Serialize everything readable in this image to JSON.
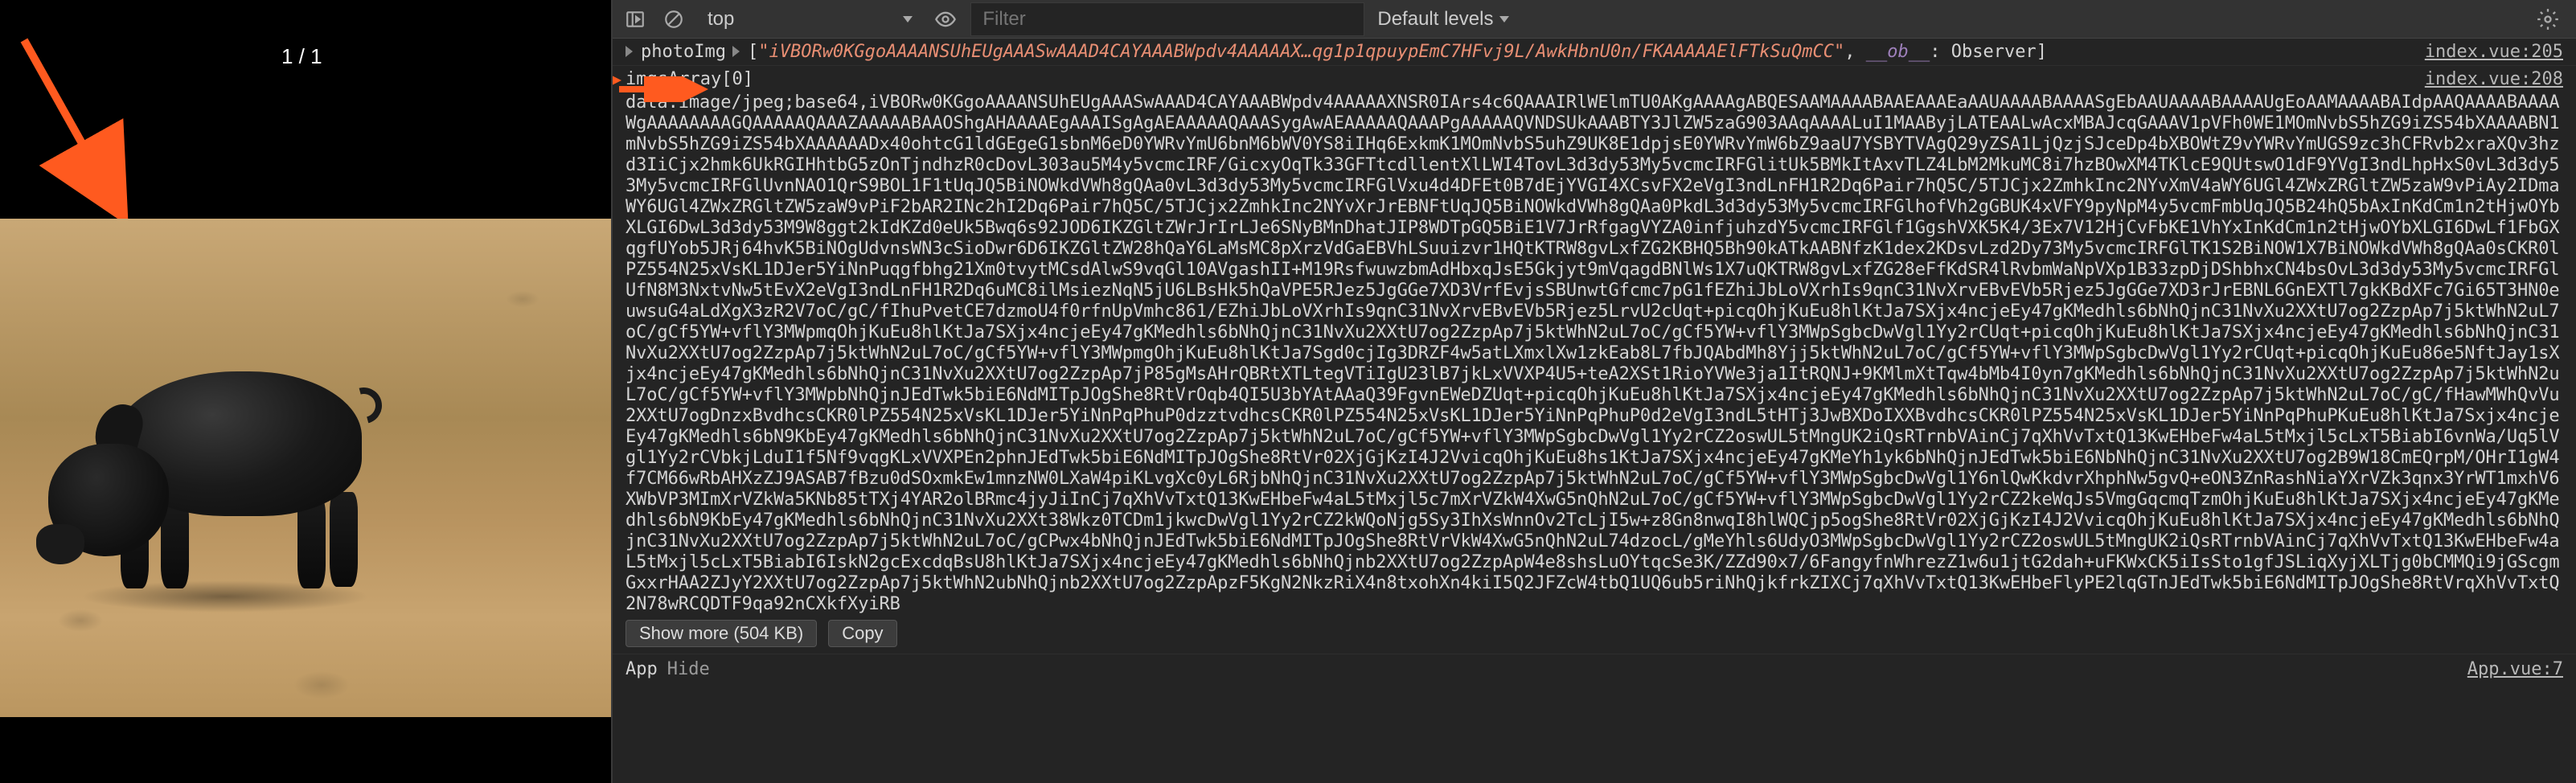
{
  "leftPanel": {
    "counter": "1 / 1"
  },
  "toolbar": {
    "context": "top",
    "filter_placeholder": "Filter",
    "levels_label": "Default levels"
  },
  "console": {
    "line1": {
      "key": "photoImg",
      "stringPreview": "\"iVBORw0KGgoAAAANSUhEUgAAASwAAAD4CAYAAABWpdv4AAAAAX…qg1p1qpuypEmC7HFvj9L/AwkHbnU0n/FKAAAAAElFTkSuQmCC\"",
      "obKey": "__ob__",
      "obVal": "Observer",
      "source": "index.vue:205"
    },
    "line2": {
      "key": "imgsArray[0]",
      "source": "index.vue:208"
    },
    "base64Prefix": "data:image/jpeg;base64,",
    "base64": "iVBORw0KGgoAAAANSUhEUgAAASwAAAD4CAYAAABWpdv4AAAAAXNSR0IArs4c6QAAAIRlWElmTU0AKgAAAAgABQESAAMAAAABAAEAAAEaAAUAAAABAAAASgEbAAUAAAABAAAAUgEoAAMAAAABAIdpAAQAAAABAAAAWgAAAAAAAAGQAAAAAQAAAZAAAAABAAOShgAHAAAAEgAAAISgAgAEAAAAAQAAASygAwAEAAAAAQAAAPgAAAAAQVNDSUkAAABTY3JlZW5zaG903AAqAAAALuI1MAAByjLATEAALwAcxMBAJcqGAAAV1pVFh0WE1MOmNvbS5hZG9iZS54bXAAAABN1mNvbS5hZG9iZS54bXAAAAAADx40ohtcG1ldGEgeG1sbnM6eD0YWRvYmU6bnM6bWV0YS8iIHq6ExkmK1MOmNvbS5uhZ9UK8E1dpjsE0YWRvYmW6bZ9aaU7YSBYTVAgQ29yZSA1LjQzjSJceDp4bXBOWtZ9vYWRvYmUGS9zc3hCFRvb2xraXQv3hzd3IiCjx2hmk6UkRGIHhtbG5zOnTjndhzR0cDovL303au5M4y5vcmcIRF/GicxyOqTk33GFTtcdllentXlLWI4TovL3d3dy53My5vcmcIRFGlitUk5BMkItAxvTLZ4LbM2MkuMC8i7hzBOwXM4TKlcE9QUtswO1dF9YVgI3ndLhpHxS0vL3d3dy53My5vcmcIRFGlUvnNAO1QrS9BOL1F1tUqJQ5BiNOWkdVWh8gQAa0vL3d3dy53My5vcmcIRFGlVxu4d4DFEt0B7dEjYVGI4XCsvFX2eVgI3ndLnFH1R2Dq6Pair7hQ5C/5TJCjx2ZmhkInc2NYvXmV4aWY6UGl4ZWxZRGltZW5zaW9vPiAy2IDmaWY6UGl4ZWxZRGltZW5zaW9vPiF2bAR2INc2hI2Dq6Pair7hQ5C/5TJCjx2ZmhkInc2NYvXrJrEBNFtUqJQ5BiNOWkdVWh8gQAa0PkdL3d3dy53My5vcmcIRFGlhofVh2gGBUK4xVFY9pyNpM4y5vcmFmbUqJQ5B24hQ5bAxInKdCm1n2tHjwOYbXLGI6DwL3d3dy53M9W8ggt2kIdKZd0eUk5Bwq6s92JOD6IKZGltZWrJrIrLJe6SNyBMnDhatJIP8WDTpGQ5BiE1V7JrRfgagVYZA0infjuhzdY5vcmcIRFGlf1GgshVXK5K4/3Ex7V12HjCvFbKE1VhYxInKdCm1n2tHjwOYbXLGI6DwLf1FbGXqgfUYob5JRj64hvK5BiNOgUdvnsWN3cSioDwr6D6IKZGltZW28hQaY6LaMsMC8pXrzVdGaEBVhLSuuizvr1HQtKTRW8gvLxfZG2KBHQ5Bh90kATkAABNfzK1dex2KDsvLzd2Dy73My5vcmcIRFGlTK1S2BiNOW1X7BiNOWkdVWh8gQAa0sCKR0lPZ554N25xVsKL1DJer5YiNnPuqgfbhg21Xm0tvytMCsdAlwS9vqGl10AVgashII+M19RsfwuwzbmAdHbxqJsE5Gkjyt9mVqagdBNlWs1X7uQKTRW8gvLxfZG28eFfKdSR4lRvbmWaNpVXp1B33zpDjDShbhxCN4bsOvL3d3dy53My5vcmcIRFGlUfN8M3NxtvNw5tEvX2eVgI3ndLnFH1R2Dq6uMC8ilMsiezNqN5jU6LBsHk5hQaVPE5RJez5JgGGe7XD3VrfEvjsSBUnwtGfcmc7pG1fEZhiJbLoVXrhIs9qnC31NvXrvEBvEVb5Rjez5JgGGe7XD3rJrEBNL6GnEXTl7gkKBdXFc7Gi65T3HN0euwsuG4aLdXgX3zR2V7oC/gC/fIhuPvetCE7dzmoU4f0rfnUpVmhc861/EZhiJbLoVXrhIs9qnC31NvXrvEBvEVb5Rjez5LrvU2cUqt+picqOhjKuEu8hlKtJa7SXjx4ncjeEy47gKMedhls6bNhQjnC31NvXu2XXtU7og2ZzpAp7j5ktWhN2uL7oC/gCf5YW+vflY3MWpmqOhjKuEu8hlKtJa7SXjx4ncjeEy47gKMedhls6bNhQjnC31NvXu2XXtU7og2ZzpAp7j5ktWhN2uL7oC/gCf5YW+vflY3MWpSgbcDwVgl1Yy2rCUqt+picqOhjKuEu8hlKtJa7SXjx4ncjeEy47gKMedhls6bNhQjnC31NvXu2XXtU7og2ZzpAp7j5ktWhN2uL7oC/gCf5YW+vflY3MWpmgOhjKuEu8hlKtJa7Sgd0cjIg3DRZF4w5atLXmxlXw1zkEab8L7fbJQAbdMh8Yjj5ktWhN2uL7oC/gCf5YW+vflY3MWpSgbcDwVgl1Yy2rCUqt+picqOhjKuEu86e5NftJay1sXjx4ncjeEy47gKMedhls6bNhQjnC31NvXu2XXtU7og2ZzpAp7jP85gMsAHrQBRtXTLtegVTiIgU23lB7jkLxVVXP4U5+teA2XSt1RioYVWe3ja1ItRQNJ+9KMlmXtTqw4bMb4I0yn7gKMedhls6bNhQjnC31NvXu2XXtU7og2ZzpAp7j5ktWhN2uL7oC/gCf5YW+vflY3MWpbNhQjnJEdTwk5biE6NdMITpJOgShe8RtVrOqb4QI5U3bYAtAAaQ39FgvnEWeDZUqt+picqOhjKuEu8hlKtJa7SXjx4ncjeEy47gKMedhls6bNhQjnC31NvXu2XXtU7og2ZzpAp7j5ktWhN2uL7oC/gC/fHawMWhQvVu2XXtU7ogDnzxBvdhcsCKR0lPZ554N25xVsKL1DJer5YiNnPqPhuP0dzztvdhcsCKR0lPZ554N25xVsKL1DJer5YiNnPqPhuP0d2eVgI3ndL5tHTj3JwBXDoIXXBvdhcsCKR0lPZ554N25xVsKL1DJer5YiNnPqPhuPKuEu8hlKtJa7Sxjx4ncjeEy47gKMedhls6bN9KbEy47gKMedhls6bNhQjnC31NvXu2XXtU7og2ZzpAp7j5ktWhN2uL7oC/gCf5YW+vflY3MWpSgbcDwVgl1Yy2rCZ2oswUL5tMngUK2iQsRTrnbVAinCj7qXhVvTxtQ13KwEHbeFw4aL5tMxjl5cLxT5BiabI6vnWa/Uq5lVgl1Yy2rCVbkjLduI1f5Nf9vqgKLxVVXPEn2phnJEdTwk5biE6NdMITpJOgShe8RtVr02XjGjKzI4J2VvicqOhjKuEu8hs1KtJa7SXjx4ncjeEy47gKMeYh1yk6bNhQjnJEdTwk5biE6NbNhQjnC31NvXu2XXtU7og2B9W18CmEQrpM/OHrI1gW4f7CM66wRbAHXzZJ9ASAB7fBzu0dSOxmkEw1mnzNW0LXaW4piKLvgXc0yL6RjbNhQjnC31NvXu2XXtU7og2ZzpAp7j5ktWhN2uL7oC/gCf5YW+vflY3MWpSgbcDwVgl1Y6nlQwKkdvrXhphNw5gvQ+eON3ZnRashNiaYXrVZk3qnx3YrWT1mxhV6XWbVP3MImXrVZkWa5KNb85tTXj4YAR2olBRmc4jyJiInCj7qXhVvTxtQ13KwEHbeFw4aL5tMxjl5c7mXrVZkW4XwG5nQhN2uL7oC/gCf5YW+vflY3MWpSgbcDwVgl1Yy2rCZ2keWqJs5VmgGqcmqTzmOhjKuEu8hlKtJa7SXjx4ncjeEy47gKMedhls6bN9KbEy47gKMedhls6bNhQjnC31NvXu2XXt38Wkz0TCDm1jkwcDwVgl1Yy2rCZ2kWQoNjg5Sy3IhXsWnnOv2TcLjI5w+z8Gn8nwqI8hlWQCjp5ogShe8RtVr02XjGjKzI4J2VvicqOhjKuEu8hlKtJa7SXjx4ncjeEy47gKMedhls6bNhQjnC31NvXu2XXtU7og2ZzpAp7j5ktWhN2uL7oC/gCPwx4bNhQjnJEdTwk5biE6NdMITpJOgShe8RtVrVkW4XwG5nQhN2uL74dzocL/gMeYhls6UdyO3MWpSgbcDwVgl1Yy2rCZ2oswUL5tMngUK2iQsRTrnbVAinCj7qXhVvTxtQ13KwEHbeFw4aL5tMxjl5cLxT5BiabI6IskN2gcExcdqBsU8hlKtJa7SXjx4ncjeEy47gKMedhls6bNhQjnb2XXtU7og2ZzpApW4e8shsLuOYtqcSe3K/ZZd90x7/6FangyfnWhrezZ1w6u1jtG2dah+uFKWxCK5iIsSto1gfJSLiqXyjXLTjg0bCMMQi9jGScgmGxxrHAA2ZJyY2XXtU7og2ZzpAp7j5ktWhN2ubNhQjnb2XXtU7og2ZzpApzF5KgN2NkzRiX4n8txohXn4kiI5Q2JFZcW4tbQ1UQ6ub5riNhQjkfrkZIXCj7qXhVvTxtQ13KwEHbeFlyPE2lqGTnJEdTwk5biE6NdMITpJOgShe8RtVrqXhVvTxtQ2N78wRCQDTF9qa92nCXkfXyiRB",
    "showMore": "Show more (504 KB)",
    "copy": "Copy",
    "appLabel": "App",
    "hideLabel": "Hide",
    "appSource": "App.vue:7"
  }
}
